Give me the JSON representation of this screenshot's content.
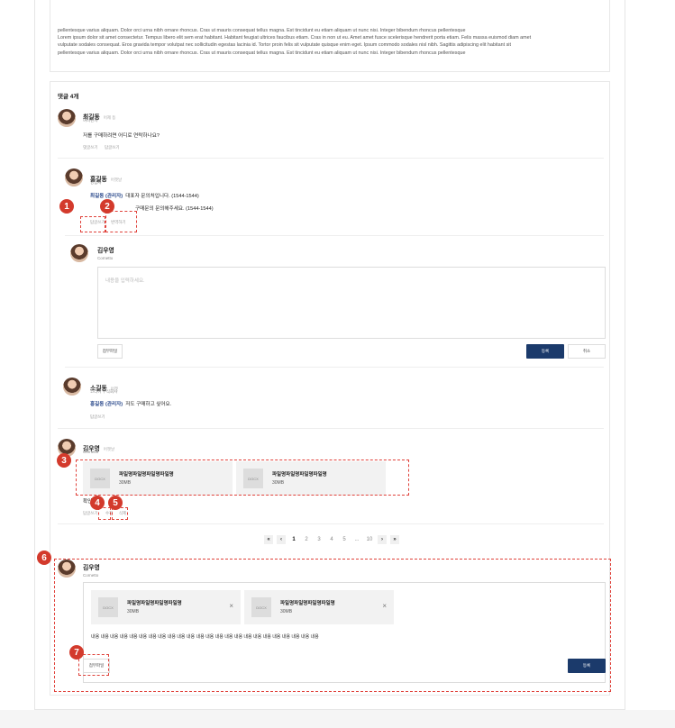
{
  "article": {
    "line1": "pellentesque varius aliquam. Dolor orci urna nibh ornare rhoncus. Cras ut mauris consequat tellus magna. Est tincidunt eu etiam aliquam ut nunc nisi. Integer bibendum rhoncus pellentesque",
    "line2": "Lorem ipsum dolor sit amet consectetur. Tempus libero elit sem erat habitant. Habitant feugiat ultrices faucibus etiam. Cras in non ut eu. Amet amet fusce scelerisque hendrerit porta etiam. Felis massa euismod diam amet",
    "line3": "vulputate sodales consequat. Eros gravida tempor volutpat nec sollicitudin egestas lacinia id. Tortor proin felis sit vulputate quisque enim eget. Ipsum commodo sodales nisl nibh. Sagittis adipiscing elit habitant sit",
    "line4": "pellentesque varius aliquam. Dolor orci urna nibh ornare rhoncus. Cras ut mauris consequat tellus magna. Est tincidunt eu etiam aliquam ut nunc nisi. Integer bibendum rhoncus pellentesque"
  },
  "comments": {
    "title": "댓글 4개",
    "c1": {
      "name": "최길동",
      "date": "어제 등",
      "role": "여니한자",
      "text": "저를 구매하려면 어디로 연락하나요?",
      "reply": "댓글쓰기",
      "delete": "답글쓰기"
    },
    "c2": {
      "name": "홍길동",
      "date": "어젯날",
      "role": "영업자",
      "mention": "최길동 (관리자)",
      "text": "대표자 문의처입니다. (1544-1544)",
      "text2": "구매문의 문의해주세요. (1544-1544)",
      "reply": "답글쓰기",
      "edit": "번역하기"
    },
    "editor1": {
      "name": "김우영",
      "role": "Cornetto",
      "placeholder": "내용을 입력하세요.",
      "attach": "첨부파일",
      "submit": "등록",
      "cancel": "취소"
    },
    "c3": {
      "name": "소길동",
      "date": "어젯",
      "role": "코리아 주식회사",
      "mention": "홍길동 (관리자)",
      "text": "저도 구매하고 싶어요.",
      "reply": "답글쓰기"
    },
    "c4": {
      "name": "김우영",
      "date": "어젯날",
      "role": "Cornetto",
      "file1": {
        "thumb": "DOCX",
        "name": "파일명파일명파일명파일명",
        "size": "30MB"
      },
      "file2": {
        "thumb": "DOCX",
        "name": "파일명파일명파일명파일명",
        "size": "30MB"
      },
      "text": "확인",
      "reply": "답글쓰기",
      "edit": "수정",
      "delete": "삭제"
    }
  },
  "pagination": {
    "first": "«",
    "prev": "‹",
    "pages": [
      "1",
      "2",
      "3",
      "4",
      "5",
      "...",
      "10"
    ],
    "next": "›",
    "last": "»"
  },
  "composer": {
    "name": "김우영",
    "role": "Cornetto",
    "file1": {
      "thumb": "DOCX",
      "name": "파일명파일명파일명파일명",
      "size": "30MB"
    },
    "file2": {
      "thumb": "DOCX",
      "name": "파일명파일명파일명파일명",
      "size": "30MB"
    },
    "text": "내용 내용 내용 내용 내용 내용 내용 내용 내용 내용 내용 내용 내용 내용 내용 내용 내용 내용 내용 내용 내용 내용 내용 내용",
    "attach": "첨부파일",
    "submit": "등록",
    "remove_icon": "×"
  },
  "markers": [
    "1",
    "2",
    "3",
    "4",
    "5",
    "6",
    "7"
  ],
  "colors": {
    "accent": "#1b3a6b",
    "marker": "#d33a2c",
    "mention": "#2b4a8c"
  }
}
